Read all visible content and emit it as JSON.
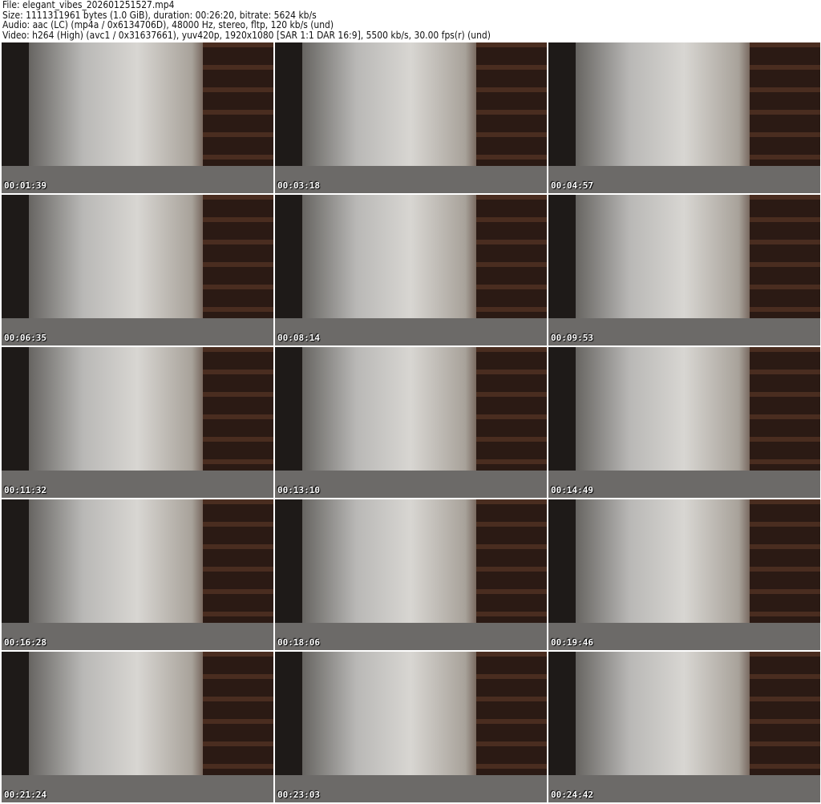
{
  "info": {
    "file": "File: elegant_vibes_202601251527.mp4",
    "size": "Size: 1111311961 bytes (1.0 GiB), duration: 00:26:20, bitrate: 5624 kb/s",
    "audio": "Audio: aac (LC) (mp4a / 0x6134706D), 48000 Hz, stereo, fltp, 120 kb/s (und)",
    "video": "Video: h264 (High) (avc1 / 0x31637661), yuv420p, 1920x1080 [SAR 1:1 DAR 16:9], 5500 kb/s, 30.00 fps(r) (und)"
  },
  "thumbnails": [
    "00:01:39",
    "00:03:18",
    "00:04:57",
    "00:06:35",
    "00:08:14",
    "00:09:53",
    "00:11:32",
    "00:13:10",
    "00:14:49",
    "00:16:28",
    "00:18:06",
    "00:19:46",
    "00:21:24",
    "00:23:03",
    "00:24:42"
  ]
}
